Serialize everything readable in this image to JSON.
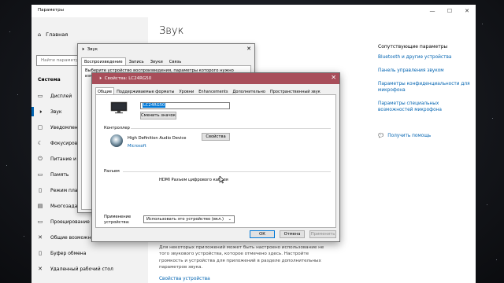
{
  "settings": {
    "window_title": "Параметры",
    "controls": {
      "minimize": "—",
      "maximize": "☐",
      "close": "✕"
    },
    "home_label": "Главная",
    "search_placeholder": "Найти параметр",
    "section_label": "Система",
    "sidebar_items": [
      {
        "label": "Дисплей",
        "icon": "display-icon",
        "glyph": "▭"
      },
      {
        "label": "Звук",
        "icon": "speaker-icon",
        "glyph": "🕨"
      },
      {
        "label": "Уведомления и действия",
        "icon": "notification-icon",
        "glyph": "▢"
      },
      {
        "label": "Фокусировка внимания",
        "icon": "moon-icon",
        "glyph": "☾"
      },
      {
        "label": "Питание и спящий режим",
        "icon": "power-icon",
        "glyph": "⏻"
      },
      {
        "label": "Память",
        "icon": "storage-icon",
        "glyph": "▭"
      },
      {
        "label": "Режим планшета",
        "icon": "tablet-icon",
        "glyph": "▯"
      },
      {
        "label": "Многозадачность",
        "icon": "multitask-icon",
        "glyph": "▤"
      },
      {
        "label": "Проецирование на этот компьютер",
        "icon": "project-icon",
        "glyph": "▭"
      },
      {
        "label": "Общие возможности",
        "icon": "share-icon",
        "glyph": "✕"
      },
      {
        "label": "Буфер обмена",
        "icon": "clipboard-icon",
        "glyph": "▯"
      },
      {
        "label": "Удаленный рабочий стол",
        "icon": "remote-icon",
        "glyph": "✕"
      }
    ],
    "main_title": "Звук",
    "related": {
      "heading": "Сопутствующие параметры",
      "links": [
        "Bluetooth и другие устройства",
        "Панель управления звуком",
        "Параметры конфиденциальности для микрофона",
        "Параметры специальных возможностей микрофона"
      ]
    },
    "help_link": "Получить помощь",
    "bottom_text": "Для некоторых приложений может быть настроено использование не того звукового устройства, которое отмечено здесь. Настройте громкость и устройства для приложений в разделе дополнительных параметров звука.",
    "bottom_link": "Свойства устройства"
  },
  "sound_dialog": {
    "title": "Звук",
    "close": "✕",
    "tabs": [
      "Воспроизведение",
      "Запись",
      "Звуки",
      "Связь"
    ],
    "active_tab": 0,
    "instruction": "Выберите устройство воспроизведения, параметры которого нужно изменить:"
  },
  "props_dialog": {
    "title": "Свойства: LC24RG50",
    "close": "✕",
    "tabs": [
      "Общие",
      "Поддерживаемые форматы",
      "Уровни",
      "Enhancements",
      "Дополнительно",
      "Пространственный звук"
    ],
    "active_tab": 0,
    "device_name": "LC24RG50",
    "change_icon_label": "Сменить значок",
    "controller_label": "Контроллер",
    "controller_name": "High Definition Audio Device",
    "controller_vendor": "Microsoft",
    "properties_button": "Свойства",
    "jack_label": "Разъем",
    "connection": "HDMI Разъем цифрового кабеля",
    "usage_label": "Применение устройства:",
    "usage_value": "Использовать это устройство (вкл.)",
    "ok_button": "ОК",
    "cancel_button": "Отмена",
    "apply_button": "Применить"
  },
  "colors": {
    "accent": "#0063b1",
    "dialog_title": "#a84e5a"
  }
}
